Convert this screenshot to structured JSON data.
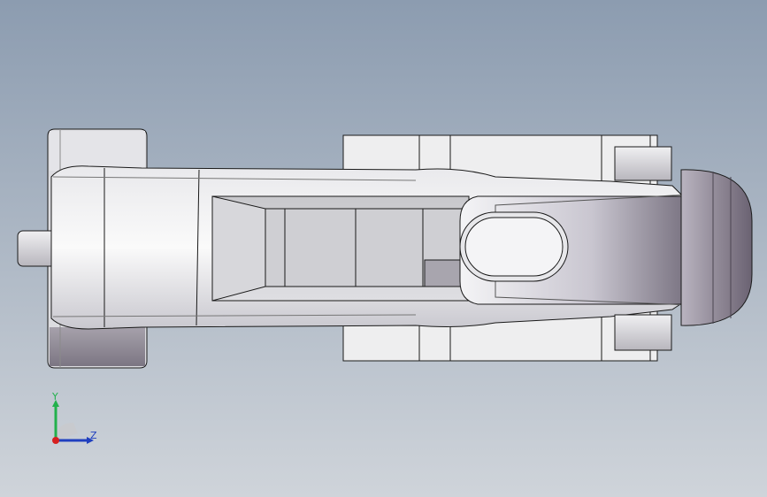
{
  "viewport": {
    "background_top": "#8c9cb0",
    "background_bottom": "#cfd4da"
  },
  "model": {
    "body_light": "#f1f1f3",
    "body_mid": "#cfcfd4",
    "body_dark": "#8d8893",
    "edge_color": "#1a1a1a"
  },
  "triad": {
    "y_label": "Y",
    "z_label": "Z",
    "y_color": "#22b14c",
    "z_color": "#1f3fbf",
    "x_color": "#d62020"
  }
}
